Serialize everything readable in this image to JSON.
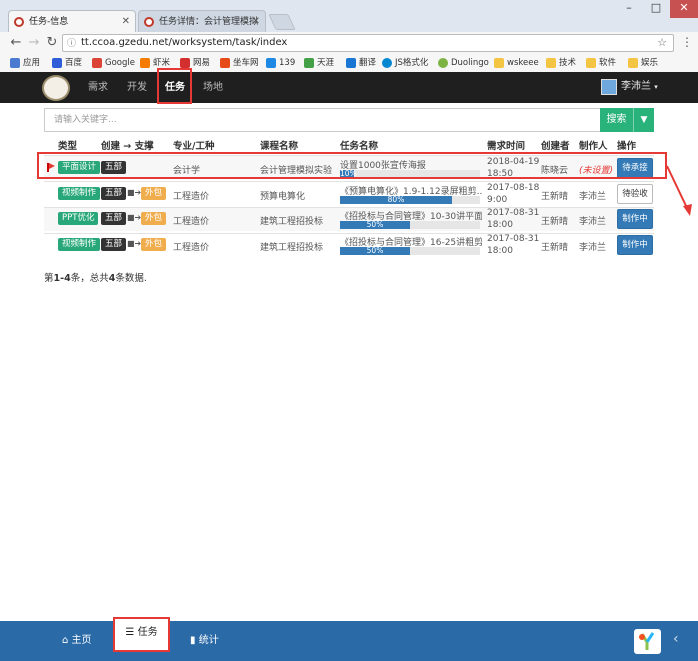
{
  "browser": {
    "tabs": [
      {
        "title": "任务-信息"
      },
      {
        "title": "任务详情：会计管理模拟"
      }
    ],
    "url": "tt.ccoa.gzedu.net/worksystem/task/index",
    "bookmarks": [
      "应用",
      "百度",
      "Google",
      "虾米",
      "网易",
      "坐车网",
      "139",
      "天涯",
      "翻译",
      "JS格式化",
      "Duolingo",
      "wskeee",
      "技术",
      "软件",
      "娱乐"
    ],
    "window_controls": {
      "minimize": "–",
      "maximize": "□",
      "close": "✕"
    }
  },
  "header": {
    "nav": [
      "需求",
      "开发",
      "任务",
      "场地"
    ],
    "active": "任务",
    "user_name": "李沛兰"
  },
  "search": {
    "placeholder": "请输入关键字...",
    "button_label": "搜索"
  },
  "table": {
    "headers": [
      "类型",
      "创建 → 支撑",
      "专业/工种",
      "课程名称",
      "任务名称",
      "需求时间",
      "创建者",
      "制作人",
      "操作"
    ],
    "rows": [
      {
        "flag": true,
        "type": "平面设计",
        "dept": "五部",
        "outsource": "",
        "major": "会计学",
        "course": "会计管理模拟实验",
        "task": "设置1000张宣传海报",
        "progress": 10,
        "progress_label": "10%",
        "date": "2018-04-19",
        "time": "18:50",
        "creator": "陈晓云",
        "maker": "(未设置)",
        "action": "待承接",
        "action_style": "primary"
      },
      {
        "flag": false,
        "type": "视频制作",
        "dept": "五部",
        "outsource": "外包",
        "major": "工程造价",
        "course": "预算电算化",
        "task": "《预算电算化》1.9-1.12录屏粗剪...",
        "progress": 80,
        "progress_label": "80%",
        "date": "2017-08-18",
        "time": "9:00",
        "creator": "王新晴",
        "maker": "李沛兰",
        "action": "待验收",
        "action_style": "default"
      },
      {
        "flag": false,
        "type": "PPT优化",
        "dept": "五部",
        "outsource": "外包",
        "major": "工程造价",
        "course": "建筑工程招投标",
        "task": "《招投标与合同管理》10-30讲平面...",
        "progress": 50,
        "progress_label": "50%",
        "date": "2017-08-31",
        "time": "18:00",
        "creator": "王新晴",
        "maker": "李沛兰",
        "action": "制作中",
        "action_style": "primary"
      },
      {
        "flag": false,
        "type": "视频制作",
        "dept": "五部",
        "outsource": "外包",
        "major": "工程造价",
        "course": "建筑工程招投标",
        "task": "《招投标与合同管理》16-25讲粗剪...",
        "progress": 50,
        "progress_label": "50%",
        "date": "2017-08-31",
        "time": "18:00",
        "creator": "王新晴",
        "maker": "李沛兰",
        "action": "制作中",
        "action_style": "primary"
      }
    ]
  },
  "summary": {
    "prefix": "第",
    "range": "1-4",
    "middle": "条，总共",
    "total": "4",
    "suffix": "条数据."
  },
  "bottom_nav": {
    "items": [
      {
        "label": "主页",
        "icon": "home-icon"
      },
      {
        "label": "任务",
        "icon": "list-icon"
      },
      {
        "label": "统计",
        "icon": "bar-chart-icon"
      }
    ],
    "active": "任务"
  },
  "colors": {
    "brand_green": "#2ab27b",
    "primary_blue": "#337ab7",
    "bottom_bar": "#2a6aa7",
    "highlight_red": "#e53935",
    "outsource_orange": "#f0ad4e"
  }
}
